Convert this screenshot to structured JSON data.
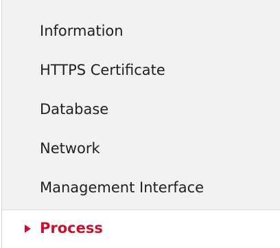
{
  "nav": {
    "items": [
      {
        "label": "Information",
        "active": false
      },
      {
        "label": "HTTPS Certificate",
        "active": false
      },
      {
        "label": "Database",
        "active": false
      },
      {
        "label": "Network",
        "active": false
      },
      {
        "label": "Management Interface",
        "active": false
      },
      {
        "label": "Process",
        "active": true,
        "marker_icon": "triangle-right-icon"
      }
    ]
  },
  "colors": {
    "panel_background": "#f2f2f2",
    "active_background": "#ffffff",
    "active_text": "#c8102e",
    "text": "#1f1f1f"
  }
}
